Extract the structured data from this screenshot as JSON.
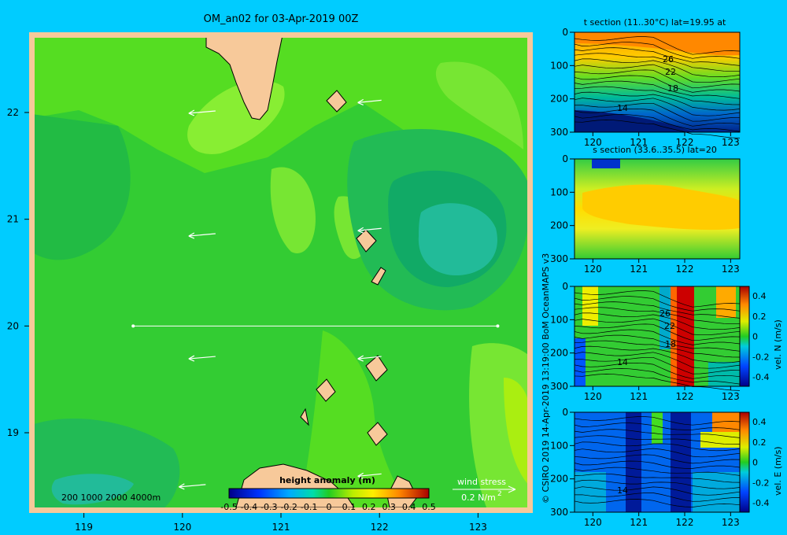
{
  "figure": {
    "title": "OM_an02 for 03-Apr-2019 00Z",
    "credit": "© CSIRO 2019   14-Apr-2019 13:19:00 BoM OceanMAPS v3"
  },
  "map": {
    "xticks": [
      "119",
      "120",
      "121",
      "122",
      "123"
    ],
    "yticks": [
      "22",
      "21",
      "20",
      "19"
    ],
    "depth_legend": "200  1000  2000  4000m",
    "wind_label": "wind stress",
    "wind_value": "0.2 N/m",
    "wind_exp": "2",
    "colorbar_title": "height anomaly (m)",
    "colorbar_ticks": [
      "-0.5",
      "-0.4",
      "-0.3",
      "-0.2",
      "-0.1",
      "0",
      "0.1",
      "0.2",
      "0.3",
      "0.4",
      "0.5"
    ]
  },
  "panels": [
    {
      "title": "t section (11..30°C) lat=19.95 at",
      "yticks": [
        "0",
        "100",
        "200",
        "300"
      ],
      "xticks": [
        "120",
        "121",
        "122",
        "123"
      ],
      "contour_labels": [
        "26",
        "22",
        "18",
        "14"
      ]
    },
    {
      "title": "s section (33.6..35.5) lat=20",
      "yticks": [
        "0",
        "100",
        "200",
        "300"
      ],
      "xticks": [
        "120",
        "121",
        "122",
        "123"
      ],
      "contour_labels": []
    },
    {
      "title": "",
      "yticks": [
        "0",
        "100",
        "200",
        "300"
      ],
      "xticks": [
        "120",
        "121",
        "122",
        "123"
      ],
      "contour_labels": [
        "26",
        "22",
        "18",
        "14"
      ],
      "cb_label": "vel. N  (m/s)",
      "cb_ticks": [
        "0.4",
        "0.2",
        "0",
        "-0.2",
        "-0.4"
      ]
    },
    {
      "title": "",
      "yticks": [
        "0",
        "100",
        "200",
        "300"
      ],
      "xticks": [
        "120",
        "121",
        "122",
        "123"
      ],
      "contour_labels": [
        "14"
      ],
      "cb_label": "vel. E  (m/s)",
      "cb_ticks": [
        "0.4",
        "0.2",
        "0",
        "-0.2",
        "-0.4"
      ]
    }
  ],
  "chart_data": {
    "type": "heatmap",
    "title": "OM_an02 for 03-Apr-2019 00Z",
    "x_range": [
      118.5,
      123.5
    ],
    "y_range": [
      18.3,
      22.7
    ],
    "variable": "height anomaly (m)",
    "color_range": [
      -0.5,
      0.5
    ],
    "section_line": {
      "lat": 20.0,
      "lon_start": 119.5,
      "lon_end": 123.2
    },
    "wind_vectors": [
      {
        "lon": 120.2,
        "lat": 22.0
      },
      {
        "lon": 121.9,
        "lat": 22.1
      },
      {
        "lon": 120.2,
        "lat": 20.85
      },
      {
        "lon": 121.9,
        "lat": 20.9
      },
      {
        "lon": 120.2,
        "lat": 19.7
      },
      {
        "lon": 121.9,
        "lat": 19.7
      },
      {
        "lon": 120.1,
        "lat": 18.5
      },
      {
        "lon": 121.9,
        "lat": 18.6
      }
    ],
    "sections": [
      {
        "name": "t section",
        "x_range": [
          119.6,
          123.2
        ],
        "depth_range": [
          0,
          300
        ],
        "value_range": [
          11,
          30
        ]
      },
      {
        "name": "s section",
        "x_range": [
          119.6,
          123.2
        ],
        "depth_range": [
          0,
          300
        ],
        "value_range": [
          33.6,
          35.5
        ]
      },
      {
        "name": "vel. N",
        "x_range": [
          119.6,
          123.2
        ],
        "depth_range": [
          0,
          300
        ],
        "value_range": [
          -0.4,
          0.4
        ]
      },
      {
        "name": "vel. E",
        "x_range": [
          119.6,
          123.2
        ],
        "depth_range": [
          0,
          300
        ],
        "value_range": [
          -0.4,
          0.4
        ]
      }
    ]
  }
}
